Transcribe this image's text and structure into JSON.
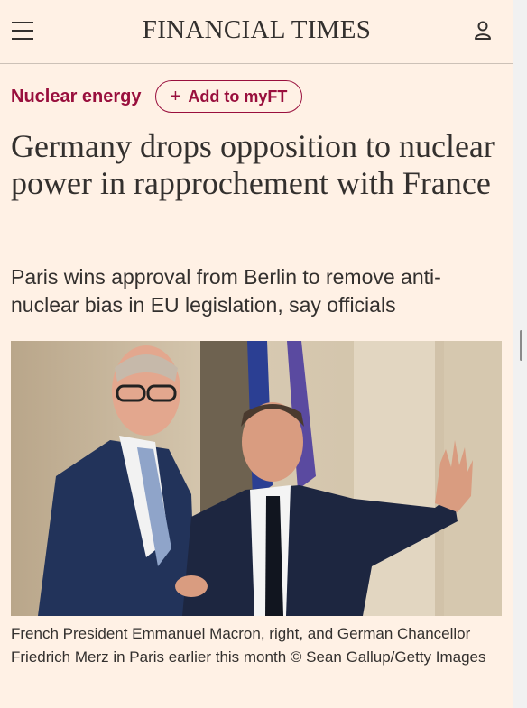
{
  "header": {
    "logo": "FINANCIAL TIMES",
    "menu_icon": "hamburger-menu-icon",
    "user_icon": "user-account-icon"
  },
  "article": {
    "topic": "Nuclear energy",
    "add_to_myft": "Add to myFT",
    "headline": "Germany drops opposition to nuclear power in rapprochement with France",
    "standfirst": "Paris wins approval from Berlin to remove anti-nuclear bias in EU legislation, say officials",
    "caption": "French President Emmanuel Macron, right, and German Chancellor Friedrich Merz in Paris earlier this month © Sean Gallup/Getty Images"
  },
  "colors": {
    "background": "#fff1e5",
    "accent": "#990f3d",
    "text": "#33302e"
  }
}
